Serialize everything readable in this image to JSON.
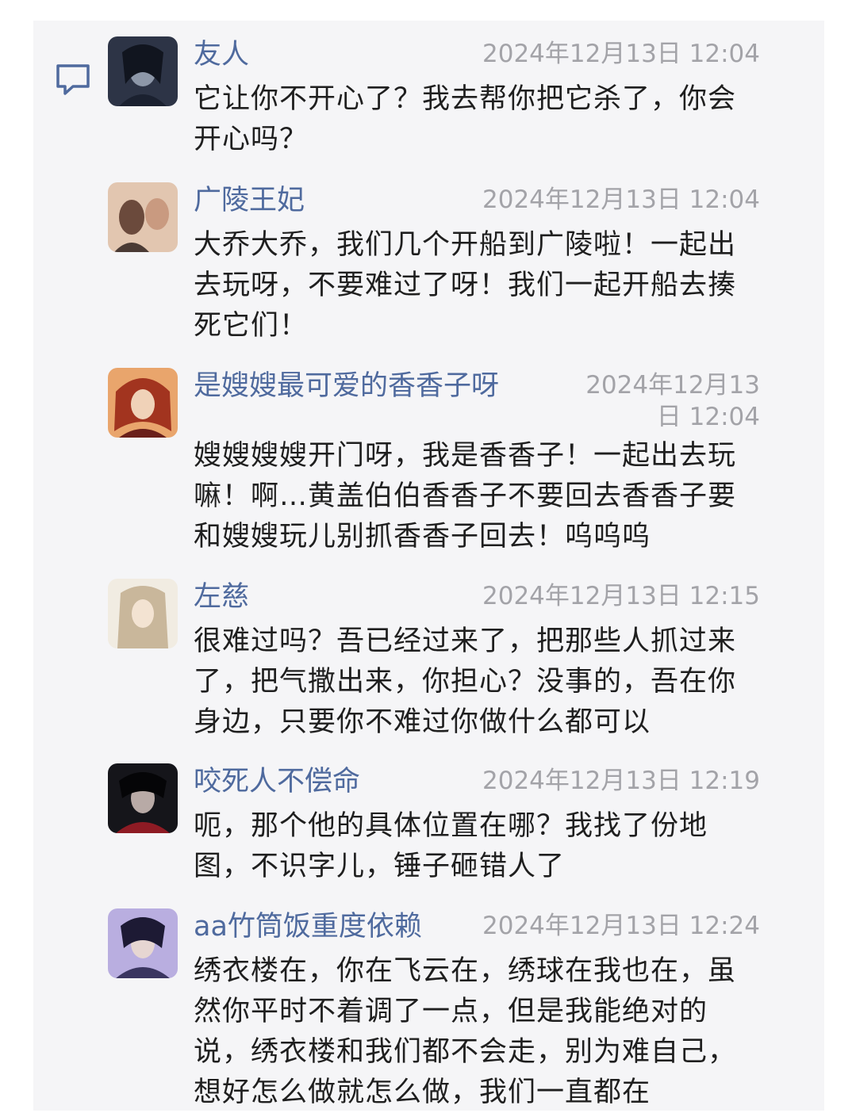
{
  "messages": [
    {
      "name": "友人",
      "time": "2024年12月13日 12:04",
      "text": "它让你不开心了？我去帮你把它杀了，你会开心吗？",
      "avatar_colors": [
        "#2d3446",
        "#8d97a8"
      ]
    },
    {
      "name": "广陵王妃",
      "time": "2024年12月13日 12:04",
      "text": "大乔大乔，我们几个开船到广陵啦！一起出去玩呀，不要难过了呀！我们一起开船去揍死它们！",
      "avatar_colors": [
        "#6b4a3c",
        "#e2c6b0"
      ]
    },
    {
      "name": "是嫂嫂最可爱的香香子呀",
      "time": "2024年12月13日 12:04",
      "text": "嫂嫂嫂嫂开门呀，我是香香子！一起出去玩嘛！啊…黄盖伯伯香香子不要回去香香子要和嫂嫂玩儿别抓香香子回去！呜呜呜",
      "avatar_colors": [
        "#a2341f",
        "#e9a56c"
      ]
    },
    {
      "name": "左慈",
      "time": "2024年12月13日 12:15",
      "text": "很难过吗？吾已经过来了，把那些人抓过来了，把气撒出来，你担心？没事的，吾在你身边，只要你不难过你做什么都可以",
      "avatar_colors": [
        "#c9b79b",
        "#f1ece2"
      ]
    },
    {
      "name": "咬死人不偿命",
      "time": "2024年12月13日 12:19",
      "text": "呃，那个他的具体位置在哪？我找了份地图，不识字儿，锤子砸错人了",
      "avatar_colors": [
        "#15151a",
        "#8e1b24"
      ]
    },
    {
      "name": "aa竹筒饭重度依赖",
      "time": "2024年12月13日 12:24",
      "text": "绣衣楼在，你在飞云在，绣球在我也在，虽然你平时不着调了一点，但是我能绝对的说，绣衣楼和我们都不会走，别为难自己，想好怎么做就怎么做，我们一直都在",
      "avatar_colors": [
        "#3a3560",
        "#b9aee0"
      ]
    }
  ],
  "icons": {
    "comment": "comment-icon"
  },
  "colors": {
    "name": "#4f6a9e",
    "time": "#a3a3a8",
    "text": "#1f1f1f",
    "panel": "#f5f5f7"
  }
}
